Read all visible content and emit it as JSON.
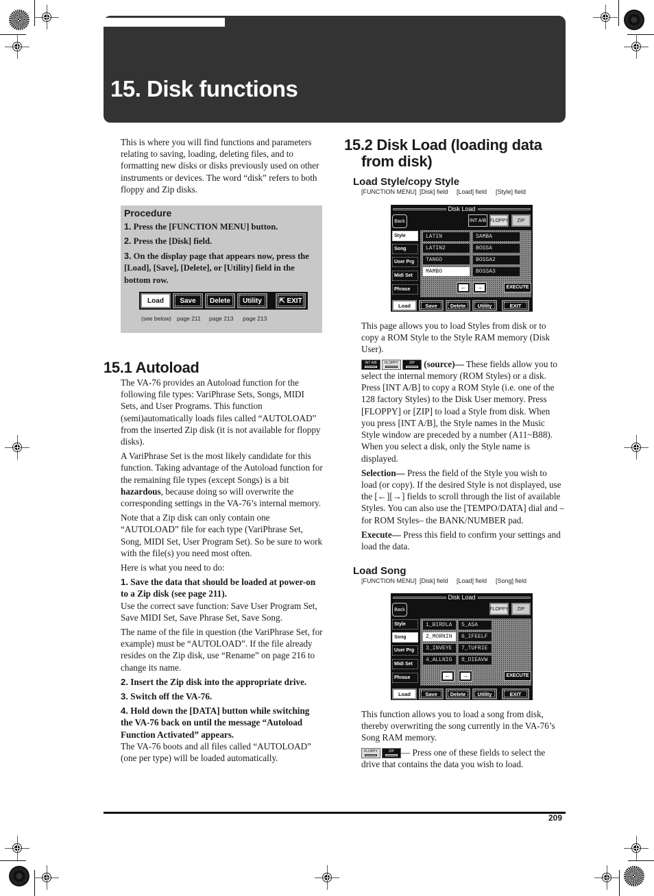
{
  "chapter": {
    "title": "15. Disk functions"
  },
  "intro": "This is where you will find functions and parameters relating to saving, loading, deleting files, and to formatting new disks or disks previously used on other instruments or devices. The word “disk” refers to both floppy and Zip disks.",
  "procedure": {
    "heading": "Procedure",
    "steps": [
      {
        "num": "1.",
        "text": "Press the [FUNCTION MENU] button."
      },
      {
        "num": "2.",
        "text": "Press the [Disk] field."
      },
      {
        "num": "3.",
        "text": "On the display page that appears now, press the [Load], [Save], [Delete], or [Utility] field in the bottom row."
      }
    ],
    "buttons": [
      "Load",
      "Save",
      "Delete",
      "Utility",
      "EXIT"
    ],
    "refs": [
      "(see below)",
      "page 211",
      "page 213",
      "page 213"
    ]
  },
  "autoload": {
    "heading": "15.1 Autoload",
    "p1": "The VA-76 provides an Autoload function for the following file types: VariPhrase Sets, Songs, MIDI Sets, and User Programs. This function (semi)automatically loads files called “AUTOLOAD” from the inserted Zip disk (it is not available for floppy disks).",
    "p2_a": "A VariPhrase Set is the most likely candidate for this function. Taking advantage of the Autoload function for the remaining file types (except Songs) is a bit ",
    "p2_bold": "hazardous",
    "p2_b": ", because doing so will overwrite the corresponding settings in the VA-76’s internal memory.",
    "p3": "Note that a Zip disk can only contain one “AUTOLOAD” file for each type (VariPhrase Set, Song, MIDI Set, User Program Set). So be sure to work with the file(s) you need most often.",
    "p4": "Here is what you need to do:",
    "step1_num": "1.",
    "step1": "Save the data that should be loaded at power-on to a Zip disk (see page 211).",
    "step1_body": "Use the correct save function: Save User Program Set, Save MIDI Set, Save Phrase Set, Save Song.",
    "step1_body2": "The name of the file in question (the VariPhrase Set, for example) must be “AUTOLOAD”. If the file already resides on the Zip disk, use “Rename” on page 216 to change its name.",
    "step2_num": "2.",
    "step2": "Insert the Zip disk into the appropriate drive.",
    "step3_num": "3.",
    "step3": "Switch off the VA-76.",
    "step4_num": "4.",
    "step4": "Hold down the [DATA] button while switching the VA-76 back on until the message “Autoload Function Activated” appears.",
    "step4_body": "The VA-76 boots and all files called “AUTOLOAD” (one per type) will be loaded automatically."
  },
  "diskload": {
    "heading": "15.2 Disk Load (loading data from disk)",
    "style": {
      "heading": "Load Style/copy Style",
      "path": [
        "[FUNCTION MENU]",
        "[Disk] field",
        "[Load] field",
        "[Style] field"
      ],
      "screen": {
        "title": "Disk Load",
        "back": "Back",
        "sources": [
          "INT A/B",
          "FLOPPY",
          "ZIP"
        ],
        "side": [
          "Style",
          "Song",
          "User Prg",
          "Midi Set",
          "Phrase"
        ],
        "side_selected": 0,
        "cells": [
          "LATIN",
          "SAMBA",
          "LATIN2",
          "BOSSA",
          "TANGO",
          "BOSSA2",
          "MAMBO",
          "BOSSA3"
        ],
        "cell_selected": 6,
        "arrows": [
          "←",
          "→"
        ],
        "execute": "EXECUTE",
        "bottom": [
          "Load",
          "Save",
          "Delete",
          "Utility",
          "EXIT"
        ]
      },
      "p1": "This page allows you to load Styles from disk or to copy a ROM Style to the Style RAM memory (Disk User).",
      "source_label": "(source)—",
      "source_text": " These fields allow you to select the internal memory (ROM Styles) or a disk. Press [INT A/B] to copy a ROM Style (i.e. one of the 128 factory Styles) to the Disk User memory. Press [FLOPPY] or [ZIP] to load a Style from disk. When you press [INT A/B], the Style names in the Music Style window are preceded by a number (A11~B88). When you select a disk, only the Style name is displayed.",
      "selection_label": "Selection—",
      "selection_text": " Press the field of the Style you wish to load (or copy). If the desired Style is not displayed, use the [←][→] fields to scroll through the list of available Styles. You can also use the [TEMPO/DATA] dial and –for ROM Styles– the BANK/NUMBER pad.",
      "execute_label": "Execute—",
      "execute_text": " Press this field to confirm your settings and load the data."
    },
    "song": {
      "heading": "Load Song",
      "path": [
        "[FUNCTION MENU]",
        "[Disk] field",
        "[Load] field",
        "[Song] field"
      ],
      "screen": {
        "title": "Disk Load",
        "back": "Back",
        "sources": [
          "FLOPPY",
          "ZIP"
        ],
        "side": [
          "Style",
          "Song",
          "User Prg",
          "Midi Set",
          "Phrase"
        ],
        "side_selected": 1,
        "cells": [
          "1_BIRDLA",
          "5_ASA",
          "2_MORNIN",
          "6_IFEELF",
          "3_INVEYE",
          "7_TUFRIE",
          "4_ALLNIG",
          "8_DIEAVW"
        ],
        "cell_selected": 2,
        "arrows": [
          "←",
          "→"
        ],
        "execute": "EXECUTE",
        "bottom": [
          "Load",
          "Save",
          "Delete",
          "Utility",
          "EXIT"
        ]
      },
      "p1": "This function allows you to load a song from disk, thereby overwriting the song currently in the VA-76’s Song RAM memory.",
      "drive_text": "— Press one of these fields to select the drive that contains the data you wish to load."
    }
  },
  "footer": {
    "page_number": "209"
  }
}
